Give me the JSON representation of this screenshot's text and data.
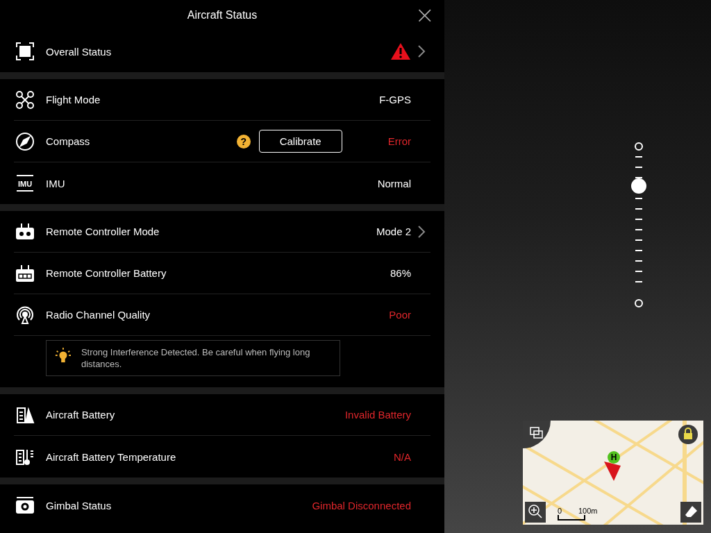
{
  "panel": {
    "title": "Aircraft Status",
    "close": "×",
    "sections": [
      {
        "rows": [
          {
            "label": "Overall Status",
            "warning": true,
            "chevron": true
          }
        ]
      },
      {
        "rows": [
          {
            "label": "Flight Mode",
            "value": "F-GPS",
            "alert": false,
            "chevron": false
          },
          {
            "label": "Compass",
            "value": "Error",
            "alert": true,
            "chevron": false,
            "help": "?",
            "button": "Calibrate"
          },
          {
            "label": "IMU",
            "icon_text": "IMU",
            "value": "Normal",
            "alert": false,
            "chevron": false
          }
        ]
      },
      {
        "rows": [
          {
            "label": "Remote Controller Mode",
            "value": "Mode 2",
            "alert": false,
            "chevron": true
          },
          {
            "label": "Remote Controller Battery",
            "value": "86%",
            "alert": false,
            "chevron": false
          },
          {
            "label": "Radio Channel Quality",
            "value": "Poor",
            "alert": true,
            "chevron": false
          }
        ],
        "tip": "Strong Interference Detected. Be careful when flying long distances."
      },
      {
        "rows": [
          {
            "label": "Aircraft Battery",
            "value": "Invalid Battery",
            "alert": true,
            "chevron": false
          },
          {
            "label": "Aircraft Battery Temperature",
            "value": "N/A",
            "alert": true,
            "chevron": false
          }
        ]
      },
      {
        "rows": [
          {
            "label": "Gimbal Status",
            "value": "Gimbal Disconnected",
            "alert": true,
            "chevron": false
          }
        ]
      }
    ]
  },
  "zoom_slider": {
    "level": 0.75
  },
  "map": {
    "home_marker": "H",
    "scale_start": "0",
    "scale_end": "100m"
  }
}
